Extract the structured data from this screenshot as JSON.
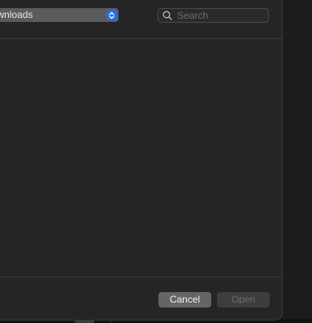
{
  "dialog": {
    "location": {
      "label": "Downloads",
      "icon": "chevron-updown-icon",
      "accent_color": "#2f6be0"
    },
    "search": {
      "placeholder": "Search",
      "value": "",
      "icon": "search-icon"
    },
    "buttons": {
      "cancel_label": "Cancel",
      "open_label": "Open",
      "open_enabled": false
    }
  }
}
